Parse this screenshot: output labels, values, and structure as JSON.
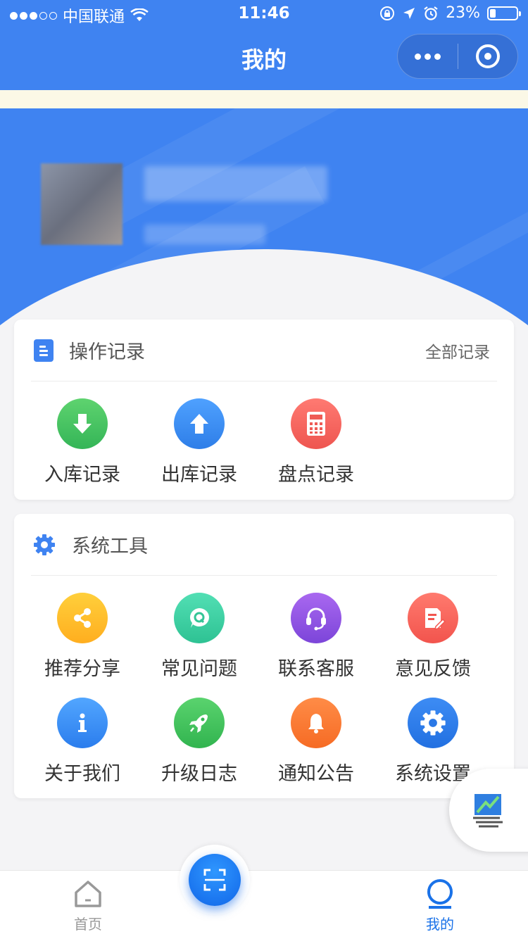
{
  "status_bar": {
    "carrier": "中国联通",
    "time": "11:46",
    "battery": "23%",
    "battery_level": 0.23,
    "signal_dots": 3
  },
  "nav": {
    "title": "我的"
  },
  "records": {
    "title": "操作记录",
    "all_link": "全部记录",
    "items": [
      {
        "label": "入库记录",
        "icon": "arrow-down-icon",
        "color": "#3dbf5e"
      },
      {
        "label": "出库记录",
        "icon": "arrow-up-icon",
        "color": "#3b8cf5"
      },
      {
        "label": "盘点记录",
        "icon": "calculator-icon",
        "color": "#f2605a"
      }
    ]
  },
  "tools": {
    "title": "系统工具",
    "items": [
      {
        "label": "推荐分享",
        "icon": "share-icon",
        "color": "#ffbd2b"
      },
      {
        "label": "常见问题",
        "icon": "faq-bubble-icon",
        "color": "#3ccfa0"
      },
      {
        "label": "联系客服",
        "icon": "headset-icon",
        "color": "#8c52e3"
      },
      {
        "label": "意见反馈",
        "icon": "feedback-doc-icon",
        "color": "#f3625a"
      },
      {
        "label": "关于我们",
        "icon": "info-icon",
        "color": "#3b8ff5"
      },
      {
        "label": "升级日志",
        "icon": "rocket-icon",
        "color": "#41c25c"
      },
      {
        "label": "通知公告",
        "icon": "bell-icon",
        "color": "#f77a33"
      },
      {
        "label": "系统设置",
        "icon": "gear-icon",
        "color": "#2d7de9"
      }
    ]
  },
  "tabbar": {
    "home_label": "首页",
    "mine_label": "我的",
    "active_color": "#1a72e8",
    "inactive_color": "#999999"
  },
  "colors": {
    "brand_blue": "#3f83f1"
  }
}
